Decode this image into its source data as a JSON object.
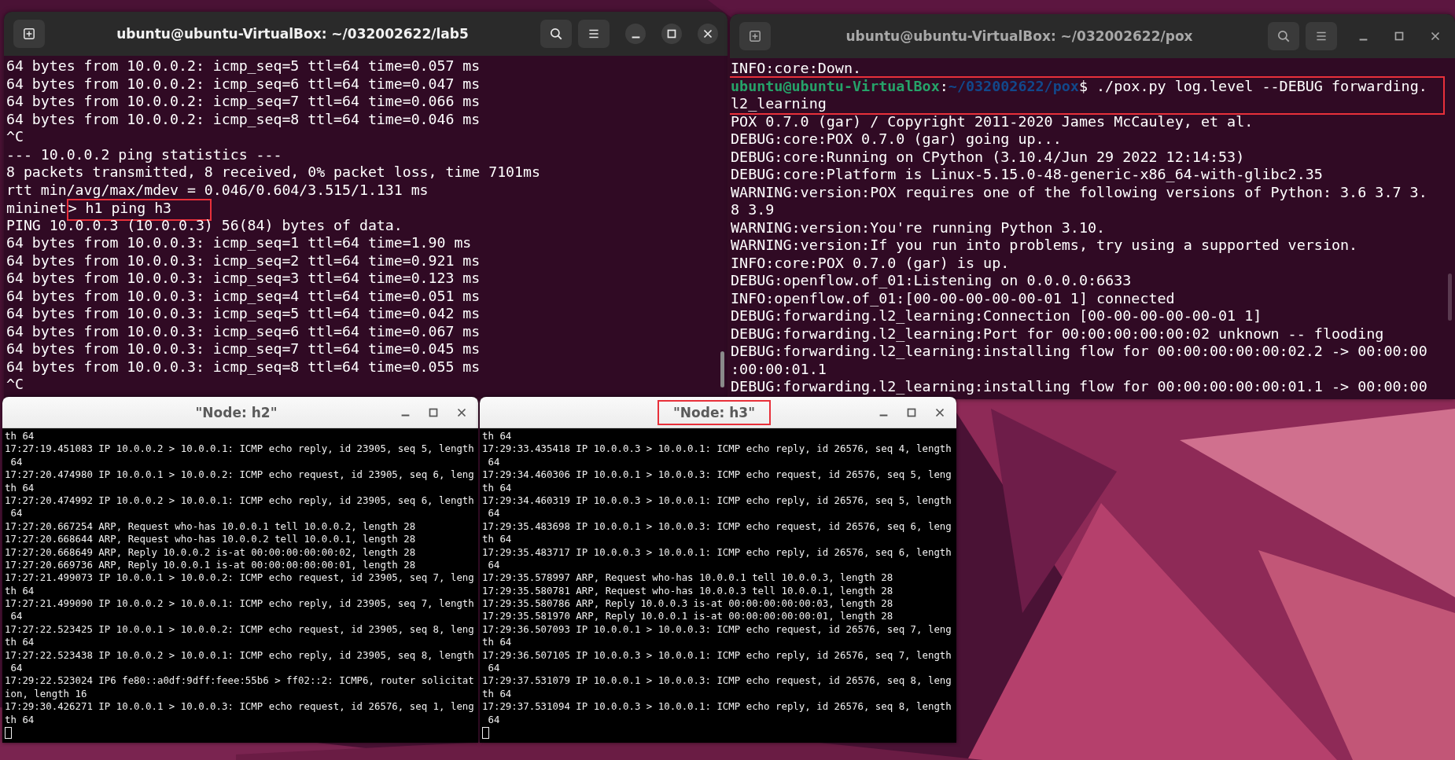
{
  "terminals": [
    {
      "title": "ubuntu@ubuntu-VirtualBox: ~/032002622/lab5",
      "focused": true,
      "lines": [
        {
          "kind": "output",
          "text": "64 bytes from 10.0.0.2: icmp_seq=5 ttl=64 time=0.057 ms"
        },
        {
          "kind": "output",
          "text": "64 bytes from 10.0.0.2: icmp_seq=6 ttl=64 time=0.047 ms"
        },
        {
          "kind": "output",
          "text": "64 bytes from 10.0.0.2: icmp_seq=7 ttl=64 time=0.066 ms"
        },
        {
          "kind": "output",
          "text": "64 bytes from 10.0.0.2: icmp_seq=8 ttl=64 time=0.046 ms"
        },
        {
          "kind": "output",
          "text": "^C"
        },
        {
          "kind": "output",
          "text": "--- 10.0.0.2 ping statistics ---"
        },
        {
          "kind": "output",
          "text": "8 packets transmitted, 8 received, 0% packet loss, time 7101ms"
        },
        {
          "kind": "output",
          "text": "rtt min/avg/max/mdev = 0.046/0.604/3.515/1.131 ms"
        },
        {
          "kind": "marked",
          "before": "mininet",
          "marked": "> h1 ping h3",
          "highlighted": true
        },
        {
          "kind": "output",
          "text": "PING 10.0.0.3 (10.0.0.3) 56(84) bytes of data."
        },
        {
          "kind": "output",
          "text": "64 bytes from 10.0.0.3: icmp_seq=1 ttl=64 time=1.90 ms"
        },
        {
          "kind": "output",
          "text": "64 bytes from 10.0.0.3: icmp_seq=2 ttl=64 time=0.921 ms"
        },
        {
          "kind": "output",
          "text": "64 bytes from 10.0.0.3: icmp_seq=3 ttl=64 time=0.123 ms"
        },
        {
          "kind": "output",
          "text": "64 bytes from 10.0.0.3: icmp_seq=4 ttl=64 time=0.051 ms"
        },
        {
          "kind": "output",
          "text": "64 bytes from 10.0.0.3: icmp_seq=5 ttl=64 time=0.042 ms"
        },
        {
          "kind": "output",
          "text": "64 bytes from 10.0.0.3: icmp_seq=6 ttl=64 time=0.067 ms"
        },
        {
          "kind": "output",
          "text": "64 bytes from 10.0.0.3: icmp_seq=7 ttl=64 time=0.045 ms"
        },
        {
          "kind": "output",
          "text": "64 bytes from 10.0.0.3: icmp_seq=8 ttl=64 time=0.055 ms"
        },
        {
          "kind": "output",
          "text": "^C"
        }
      ]
    },
    {
      "title": "ubuntu@ubuntu-VirtualBox: ~/032002622/pox",
      "focused": false,
      "lines": [
        {
          "kind": "output",
          "text": "INFO:core:Down."
        },
        {
          "kind": "shell_prompt",
          "user_host": "ubuntu@ubuntu-VirtualBox",
          "separator": ":",
          "path": "~/032002622/pox",
          "command": "$ ./pox.py log.level --DEBUG forwarding.",
          "wrapped": [
            "l2_learning"
          ],
          "highlighted": true
        },
        {
          "kind": "output",
          "text": "POX 0.7.0 (gar) / Copyright 2011-2020 James McCauley, et al."
        },
        {
          "kind": "output",
          "text": "DEBUG:core:POX 0.7.0 (gar) going up..."
        },
        {
          "kind": "output",
          "text": "DEBUG:core:Running on CPython (3.10.4/Jun 29 2022 12:14:53)"
        },
        {
          "kind": "output",
          "text": "DEBUG:core:Platform is Linux-5.15.0-48-generic-x86_64-with-glibc2.35"
        },
        {
          "kind": "output",
          "text": "WARNING:version:POX requires one of the following versions of Python: 3.6 3.7 3."
        },
        {
          "kind": "output",
          "text": "8 3.9"
        },
        {
          "kind": "output",
          "text": "WARNING:version:You're running Python 3.10."
        },
        {
          "kind": "output",
          "text": "WARNING:version:If you run into problems, try using a supported version."
        },
        {
          "kind": "output",
          "text": "INFO:core:POX 0.7.0 (gar) is up."
        },
        {
          "kind": "output",
          "text": "DEBUG:openflow.of_01:Listening on 0.0.0.0:6633"
        },
        {
          "kind": "output",
          "text": "INFO:openflow.of_01:[00-00-00-00-00-01 1] connected"
        },
        {
          "kind": "output",
          "text": "DEBUG:forwarding.l2_learning:Connection [00-00-00-00-00-01 1]"
        },
        {
          "kind": "output",
          "text": "DEBUG:forwarding.l2_learning:Port for 00:00:00:00:00:02 unknown -- flooding"
        },
        {
          "kind": "output",
          "text": "DEBUG:forwarding.l2_learning:installing flow for 00:00:00:00:00:02.2 -> 00:00:00"
        },
        {
          "kind": "output",
          "text": ":00:00:01.1"
        },
        {
          "kind": "output",
          "text": "DEBUG:forwarding.l2_learning:installing flow for 00:00:00:00:00:01.1 -> 00:00:00"
        }
      ]
    }
  ],
  "xterms": [
    {
      "title": "\"Node: h2\"",
      "highlighted": false,
      "cursor_visible": true,
      "lines": [
        "th 64",
        "17:27:19.451083 IP 10.0.0.2 > 10.0.0.1: ICMP echo reply, id 23905, seq 5, length",
        " 64",
        "17:27:20.474980 IP 10.0.0.1 > 10.0.0.2: ICMP echo request, id 23905, seq 6, leng",
        "th 64",
        "17:27:20.474992 IP 10.0.0.2 > 10.0.0.1: ICMP echo reply, id 23905, seq 6, length",
        " 64",
        "17:27:20.667254 ARP, Request who-has 10.0.0.1 tell 10.0.0.2, length 28",
        "17:27:20.668644 ARP, Request who-has 10.0.0.2 tell 10.0.0.1, length 28",
        "17:27:20.668649 ARP, Reply 10.0.0.2 is-at 00:00:00:00:00:02, length 28",
        "17:27:20.669736 ARP, Reply 10.0.0.1 is-at 00:00:00:00:00:01, length 28",
        "17:27:21.499073 IP 10.0.0.1 > 10.0.0.2: ICMP echo request, id 23905, seq 7, leng",
        "th 64",
        "17:27:21.499090 IP 10.0.0.2 > 10.0.0.1: ICMP echo reply, id 23905, seq 7, length",
        " 64",
        "17:27:22.523425 IP 10.0.0.1 > 10.0.0.2: ICMP echo request, id 23905, seq 8, leng",
        "th 64",
        "17:27:22.523438 IP 10.0.0.2 > 10.0.0.1: ICMP echo reply, id 23905, seq 8, length",
        " 64",
        "17:29:22.523024 IP6 fe80::a0df:9dff:feee:55b6 > ff02::2: ICMP6, router solicitat",
        "ion, length 16",
        "17:29:30.426271 IP 10.0.0.1 > 10.0.0.3: ICMP echo request, id 26576, seq 1, leng",
        "th 64"
      ]
    },
    {
      "title": "\"Node: h3\"",
      "highlighted": true,
      "cursor_visible": true,
      "lines": [
        "th 64",
        "17:29:33.435418 IP 10.0.0.3 > 10.0.0.1: ICMP echo reply, id 26576, seq 4, length",
        " 64",
        "17:29:34.460306 IP 10.0.0.1 > 10.0.0.3: ICMP echo request, id 26576, seq 5, leng",
        "th 64",
        "17:29:34.460319 IP 10.0.0.3 > 10.0.0.1: ICMP echo reply, id 26576, seq 5, length",
        " 64",
        "17:29:35.483698 IP 10.0.0.1 > 10.0.0.3: ICMP echo request, id 26576, seq 6, leng",
        "th 64",
        "17:29:35.483717 IP 10.0.0.3 > 10.0.0.1: ICMP echo reply, id 26576, seq 6, length",
        " 64",
        "17:29:35.578997 ARP, Request who-has 10.0.0.1 tell 10.0.0.3, length 28",
        "17:29:35.580781 ARP, Request who-has 10.0.0.3 tell 10.0.0.1, length 28",
        "17:29:35.580786 ARP, Reply 10.0.0.3 is-at 00:00:00:00:00:03, length 28",
        "17:29:35.581970 ARP, Reply 10.0.0.1 is-at 00:00:00:00:00:01, length 28",
        "17:29:36.507093 IP 10.0.0.1 > 10.0.0.3: ICMP echo request, id 26576, seq 7, leng",
        "th 64",
        "17:29:36.507105 IP 10.0.0.3 > 10.0.0.1: ICMP echo reply, id 26576, seq 7, length",
        " 64",
        "17:29:37.531079 IP 10.0.0.1 > 10.0.0.3: ICMP echo request, id 26576, seq 8, leng",
        "th 64",
        "17:29:37.531094 IP 10.0.0.3 > 10.0.0.1: ICMP echo reply, id 26576, seq 8, length",
        " 64"
      ]
    }
  ]
}
